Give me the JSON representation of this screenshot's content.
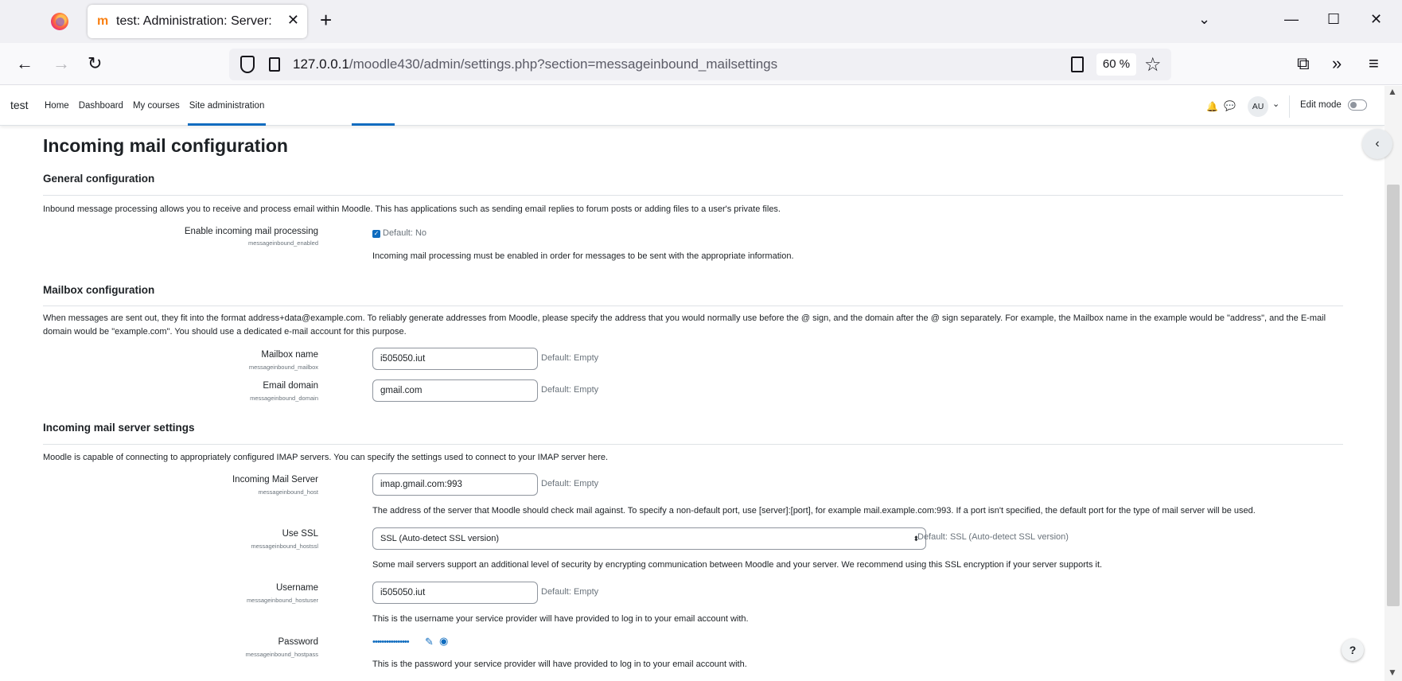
{
  "browser": {
    "tab_title": "test: Administration: Server: Email",
    "tab_favicon": "m",
    "url_host": "127.0.0.1",
    "url_rest": "/moodle430/admin/settings.php?section=messageinbound_mailsettings",
    "zoom": "60 %",
    "icons": {
      "firefox": "firefox-icon",
      "close": "close-icon",
      "new_tab": "plus-icon",
      "back": "back-arrow-icon",
      "forward": "forward-arrow-icon",
      "reload": "reload-icon"
    }
  },
  "moodle_nav": {
    "site_name": "test",
    "items": [
      {
        "label": "Home"
      },
      {
        "label": "Dashboard"
      },
      {
        "label": "My courses"
      },
      {
        "label": "Site administration",
        "active": true
      }
    ],
    "avatar": "AU",
    "edit_mode": "Edit mode"
  },
  "page": {
    "title": "Incoming mail configuration",
    "general": {
      "heading": "General configuration",
      "description": "Inbound message processing allows you to receive and process email within Moodle. This has applications such as sending email replies to forum posts or adding files to a user's private files.",
      "enable": {
        "label": "Enable incoming mail processing",
        "key": "messageinbound_enabled",
        "default": "Default: No",
        "help": "Incoming mail processing must be enabled in order for messages to be sent with the appropriate information."
      }
    },
    "mailbox": {
      "heading": "Mailbox configuration",
      "description": "When messages are sent out, they fit into the format address+data@example.com. To reliably generate addresses from Moodle, please specify the address that you would normally use before the @ sign, and the domain after the @ sign separately. For example, the Mailbox name in the example would be \"address\", and the E-mail domain would be \"example.com\". You should use a dedicated e-mail account for this purpose.",
      "mailbox_name": {
        "label": "Mailbox name",
        "key": "messageinbound_mailbox",
        "value": "i505050.iut",
        "default": "Default: Empty"
      },
      "email_domain": {
        "label": "Email domain",
        "key": "messageinbound_domain",
        "value": "gmail.com",
        "default": "Default: Empty"
      }
    },
    "server": {
      "heading": "Incoming mail server settings",
      "description": "Moodle is capable of connecting to appropriately configured IMAP servers. You can specify the settings used to connect to your IMAP server here.",
      "host": {
        "label": "Incoming Mail Server",
        "key": "messageinbound_host",
        "value": "imap.gmail.com:993",
        "default": "Default: Empty",
        "help": "The address of the server that Moodle should check mail against. To specify a non-default port, use [server]:[port], for example mail.example.com:993. If a port isn't specified, the default port for the type of mail server will be used."
      },
      "ssl": {
        "label": "Use SSL",
        "key": "messageinbound_hostssl",
        "value": "SSL (Auto-detect SSL version)",
        "default": "Default: SSL (Auto-detect SSL version)",
        "help": "Some mail servers support an additional level of security by encrypting communication between Moodle and your server. We recommend using this SSL encryption if your server supports it."
      },
      "username": {
        "label": "Username",
        "key": "messageinbound_hostuser",
        "value": "i505050.iut",
        "default": "Default: Empty",
        "help": "This is the username your service provider will have provided to log in to your email account with."
      },
      "password": {
        "label": "Password",
        "key": "messageinbound_hostpass",
        "masked": "••••••••••••••••",
        "help": "This is the password your service provider will have provided to log in to your email account with."
      }
    }
  }
}
